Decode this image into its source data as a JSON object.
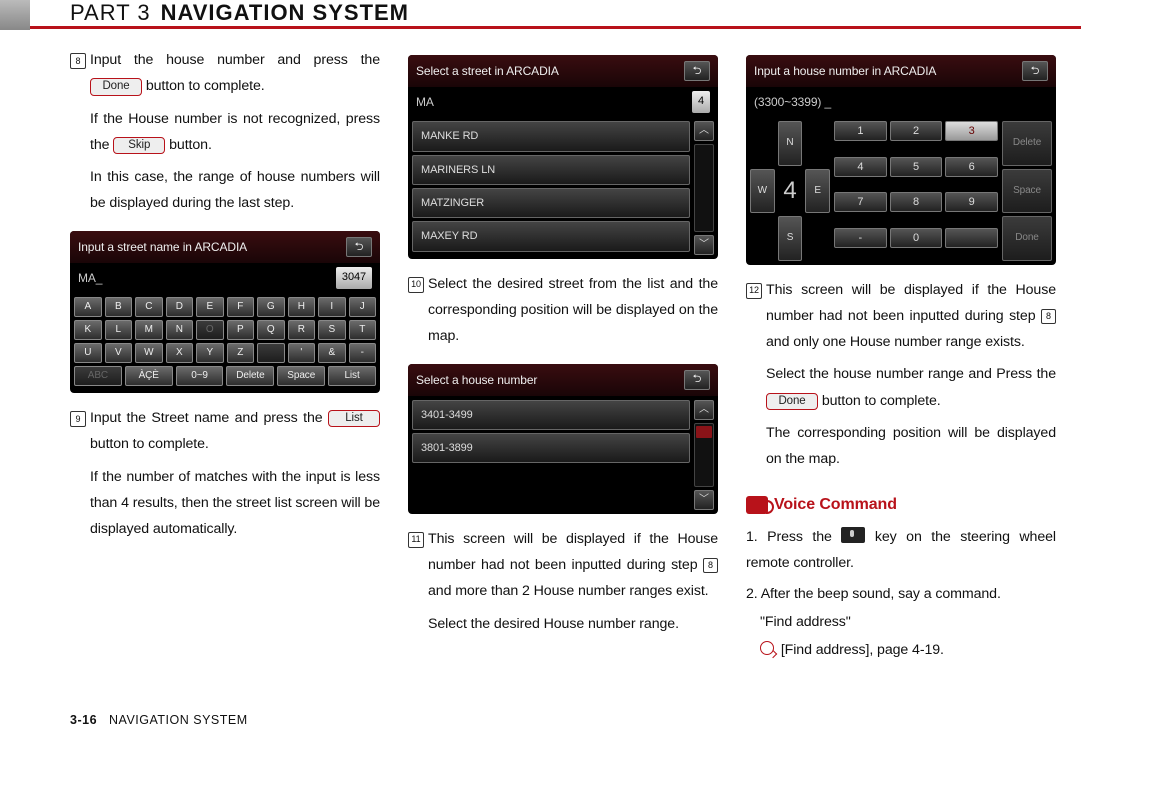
{
  "header": {
    "part_label": "PART 3",
    "title": "NAVIGATION SYSTEM"
  },
  "buttons": {
    "done": "Done",
    "skip": "Skip",
    "list": "List"
  },
  "col1": {
    "step8": {
      "num": "8",
      "line1_a": "Input the house number and press the",
      "line1_b": "button to complete.",
      "p2_a": "If the House number is not recognized, press the",
      "p2_b": "button.",
      "p3": "In this case, the range of house numbers will be displayed during the last step."
    },
    "screenshot1": {
      "title": "Input a street name in ARCADIA",
      "subtext": "MA_",
      "count": "3047",
      "rows": [
        [
          "A",
          "B",
          "C",
          "D",
          "E",
          "F",
          "G",
          "H",
          "I",
          "J"
        ],
        [
          "K",
          "L",
          "M",
          "N",
          "O",
          "P",
          "Q",
          "R",
          "S",
          "T"
        ],
        [
          "U",
          "V",
          "W",
          "X",
          "Y",
          "Z",
          "",
          "'",
          "&",
          "-"
        ]
      ],
      "bottom": [
        "ABC",
        "ÀÇÈ",
        "0~9",
        "Delete",
        "Space",
        "List"
      ]
    },
    "step9": {
      "num": "9",
      "line1_a": "Input the Street name and press the",
      "line1_b": "button to complete.",
      "p2": "If the number of matches with the input is less than 4 results, then the street list screen will be displayed automatically."
    }
  },
  "col2": {
    "screenshot2": {
      "title": "Select a street in ARCADIA",
      "subtext": "MA",
      "count": "4",
      "items": [
        "MANKE RD",
        "MARINERS LN",
        "MATZINGER",
        "MAXEY RD"
      ]
    },
    "step10": {
      "num": "10",
      "p": "Select the desired street from the list and the corresponding position will be displayed on the map."
    },
    "screenshot3": {
      "title": "Select a house number",
      "items": [
        "3401-3499",
        "3801-3899"
      ]
    },
    "step11": {
      "num": "11",
      "p1_a": "This screen will be displayed if the House number had not been inputted during step ",
      "ref8": "8",
      "p1_b": " and more than 2 House number ranges exist.",
      "p2": "Select the desired House number range."
    }
  },
  "col3": {
    "screenshot4": {
      "title": "Input a house number in ARCADIA",
      "subtext": "(3300~3399) _",
      "dpad": {
        "n": "N",
        "w": "W",
        "e": "E",
        "s": "S",
        "center": "4"
      },
      "numkeys": [
        "1",
        "2",
        "3",
        "4",
        "5",
        "6",
        "7",
        "8",
        "9",
        "-",
        "0",
        ""
      ],
      "numkeys_hl_index": 2,
      "side": [
        "Delete",
        "Space",
        "Done"
      ]
    },
    "step12": {
      "num": "12",
      "p1_a": "This screen will be displayed if the House number had not been inputted during step ",
      "ref8": "8",
      "p1_b": " and only one House number range exists.",
      "p2_a": "Select the house number range and Press the",
      "p2_b": "button to complete.",
      "p3": "The corresponding position will be displayed on the map."
    },
    "voice": {
      "heading": "Voice Command",
      "l1_a": "1. Press the",
      "l1_b": "key on the steering wheel remote controller.",
      "l2": "2. After the beep sound, say a command.",
      "cmd": "\"Find address\"",
      "ref": "[Find address], page 4-19."
    }
  },
  "footer": {
    "page": "3-16",
    "section": "NAVIGATION SYSTEM"
  }
}
